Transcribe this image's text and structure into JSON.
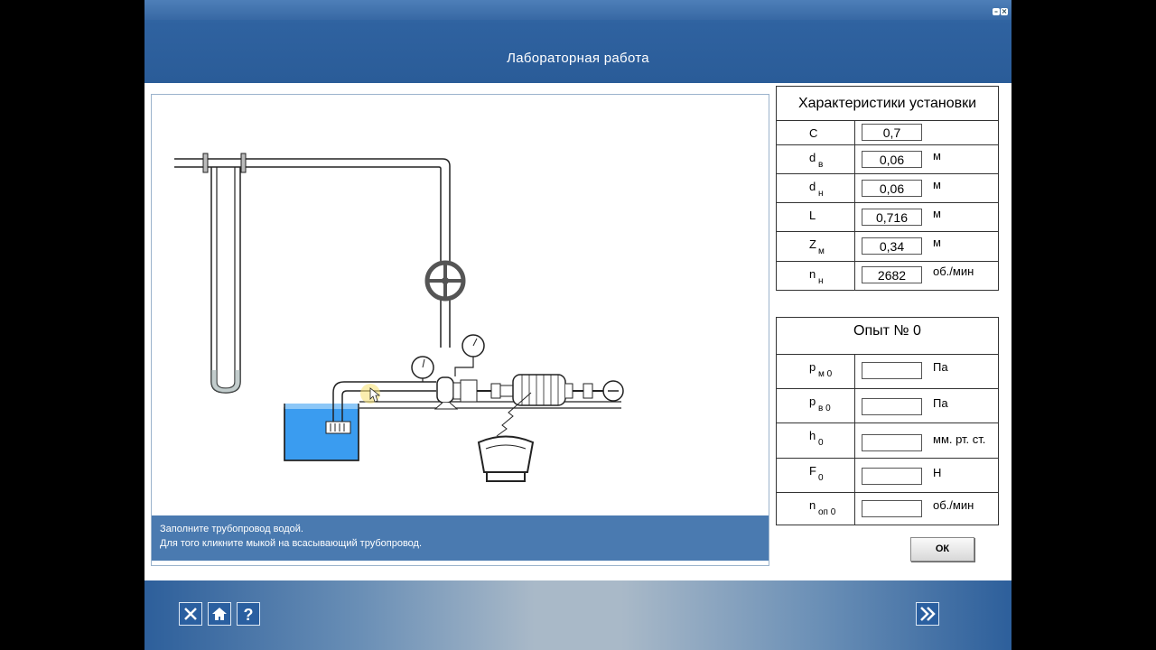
{
  "window": {
    "title": "Лабораторная работа"
  },
  "instructions": [
    "Заполните трубопровод водой.",
    "Для того кликните мыкой на всасывающий трубопровод."
  ],
  "installation": {
    "heading": "Характеристики установки",
    "rows": [
      {
        "symbol": "C",
        "sub": "",
        "value": "0,7",
        "unit": ""
      },
      {
        "symbol": "d",
        "sub": "в",
        "value": "0,06",
        "unit": "м"
      },
      {
        "symbol": "d",
        "sub": "н",
        "value": "0,06",
        "unit": "м"
      },
      {
        "symbol": "L",
        "sub": "",
        "value": "0,716",
        "unit": "м"
      },
      {
        "symbol": "Z",
        "sub": "м",
        "value": "0,34",
        "unit": "м"
      },
      {
        "symbol": "n",
        "sub": "н",
        "value": "2682",
        "unit": "об./мин"
      }
    ]
  },
  "experiment": {
    "heading": "Опыт № 0",
    "rows": [
      {
        "symbol": "p",
        "sub": "м 0",
        "value": "",
        "unit": "Па"
      },
      {
        "symbol": "p",
        "sub": "в 0",
        "value": "",
        "unit": "Па"
      },
      {
        "symbol": "h",
        "sub": "0",
        "value": "",
        "unit": "мм. рт. ст."
      },
      {
        "symbol": "F",
        "sub": "0",
        "value": "",
        "unit": "Н"
      },
      {
        "symbol": "n",
        "sub": "оп 0",
        "value": "",
        "unit": "об./мин"
      }
    ]
  },
  "buttons": {
    "ok": "ОК"
  },
  "icons": {
    "close": "close-icon",
    "home": "home-icon",
    "help": "help-icon",
    "next": "double-chevron-right-icon"
  },
  "colors": {
    "accent": "#2f62a0",
    "water": "#3a9cf0",
    "message_bar": "#4a7ab0"
  }
}
